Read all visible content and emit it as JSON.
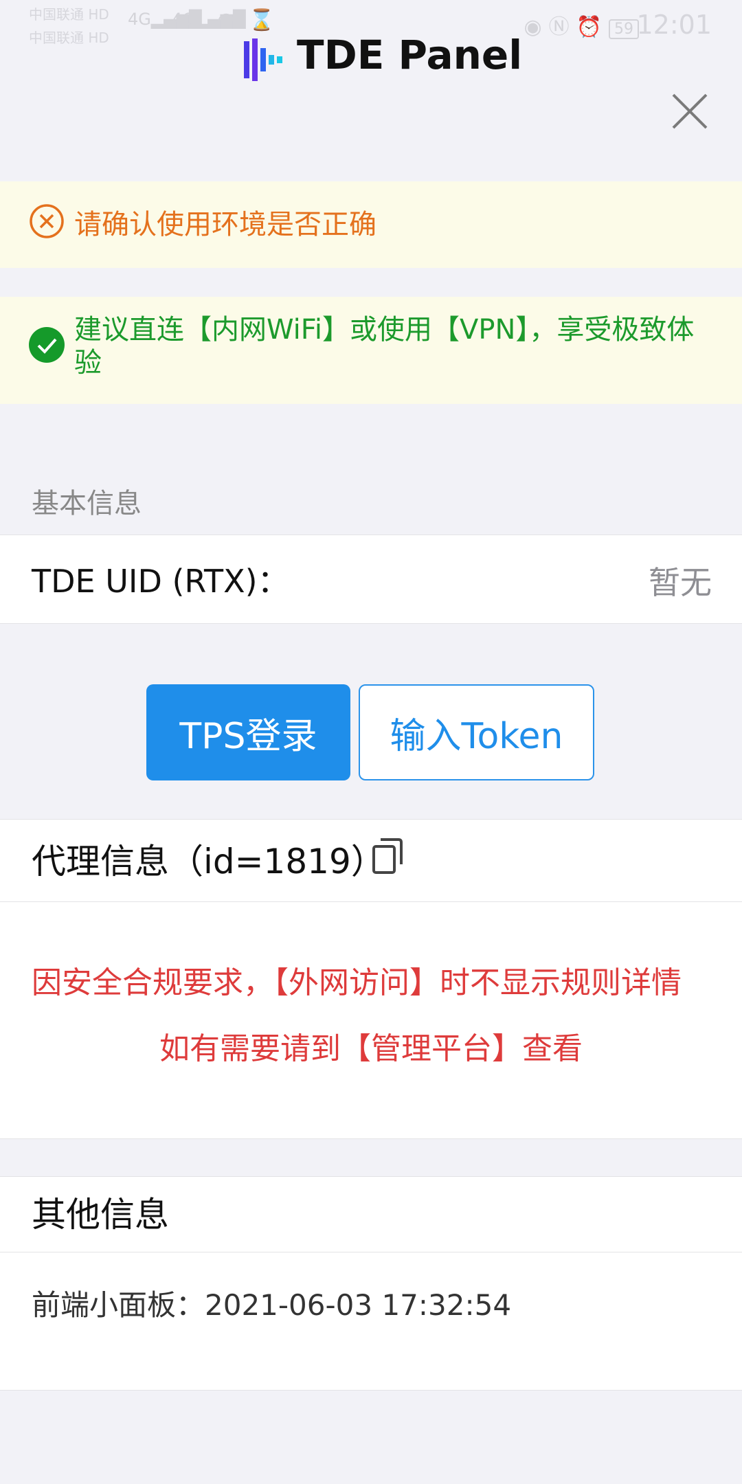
{
  "status_bar": {
    "carrier1": "中国联通",
    "carrier2": "中国联通",
    "hd": "HD",
    "net": "4G",
    "battery": "59",
    "time": "12:01"
  },
  "header": {
    "title": "TDE Panel"
  },
  "notices": {
    "env_warning": "请确认使用环境是否正确",
    "connection_tip": "建议直连【内网WiFi】或使用【VPN】，享受极致体验"
  },
  "basic_info": {
    "section_label": "基本信息",
    "uid_label": "TDE UID (RTX)：",
    "uid_value": "暂无"
  },
  "actions": {
    "tps_login": "TPS登录",
    "input_token": "输入Token"
  },
  "proxy_info": {
    "title": "代理信息（id=1819）",
    "warning_line1": "因安全合规要求，【外网访问】时不显示规则详情",
    "warning_line2": "如有需要请到【管理平台】查看"
  },
  "other_info": {
    "title": "其他信息",
    "frontend_label": "前端小面板：",
    "frontend_value": "2021-06-03 17:32:54"
  },
  "colors": {
    "primary": "#1f8eea",
    "warning_orange": "#e4711d",
    "success_green": "#1c9a2c",
    "danger_red": "#de3b3b",
    "notice_bg": "#fcfbe8"
  }
}
